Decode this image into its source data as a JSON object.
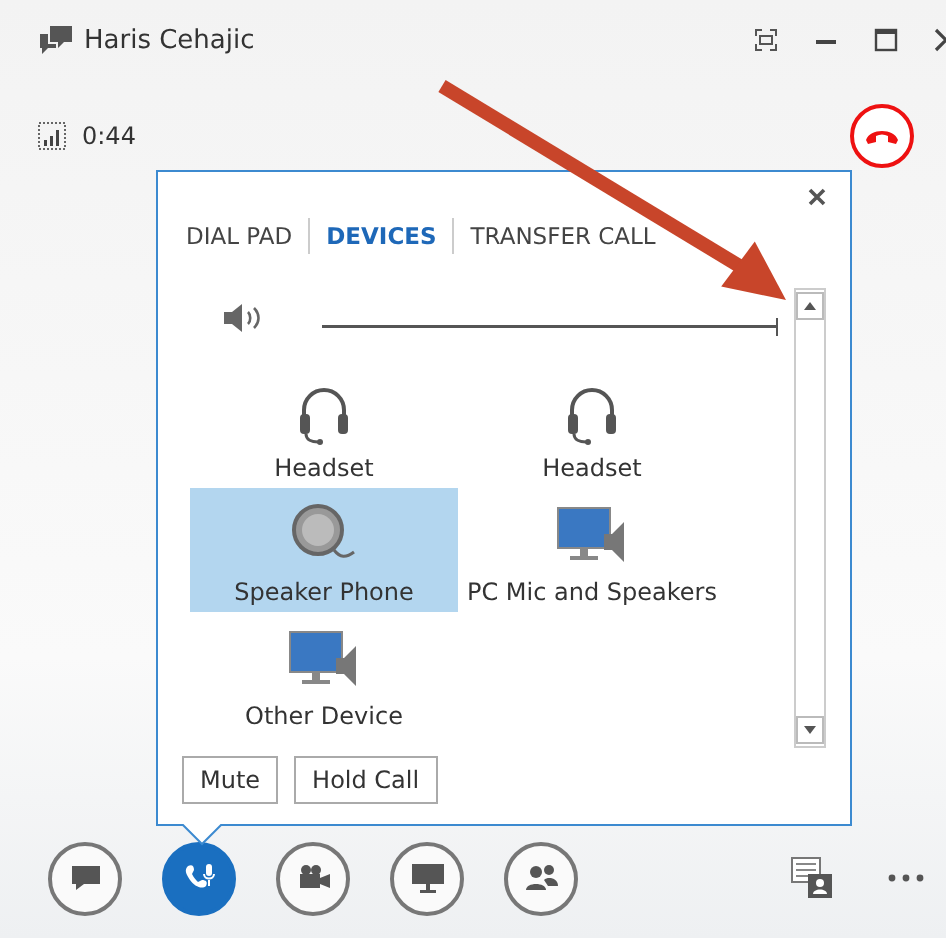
{
  "window": {
    "title": "Haris Cehajic"
  },
  "call": {
    "duration": "0:44"
  },
  "popup": {
    "tabs": [
      {
        "label": "DIAL PAD",
        "selected": false
      },
      {
        "label": "DEVICES",
        "selected": true
      },
      {
        "label": "TRANSFER CALL",
        "selected": false
      }
    ],
    "volume": {
      "level": 1
    },
    "devices": [
      {
        "label": "Headset",
        "kind": "headset",
        "selected": false
      },
      {
        "label": "Headset",
        "kind": "headset",
        "selected": false
      },
      {
        "label": "Speaker Phone",
        "kind": "speakerphone",
        "selected": true
      },
      {
        "label": "PC Mic and Speakers",
        "kind": "pc",
        "selected": false
      },
      {
        "label": "Other Device",
        "kind": "pc",
        "selected": false
      }
    ],
    "buttons": [
      "Mute",
      "Hold Call"
    ]
  },
  "toolbar": [
    {
      "kind": "chat",
      "selected": false
    },
    {
      "kind": "call",
      "selected": true
    },
    {
      "kind": "video",
      "selected": false
    },
    {
      "kind": "screen",
      "selected": false
    },
    {
      "kind": "people",
      "selected": false
    }
  ]
}
